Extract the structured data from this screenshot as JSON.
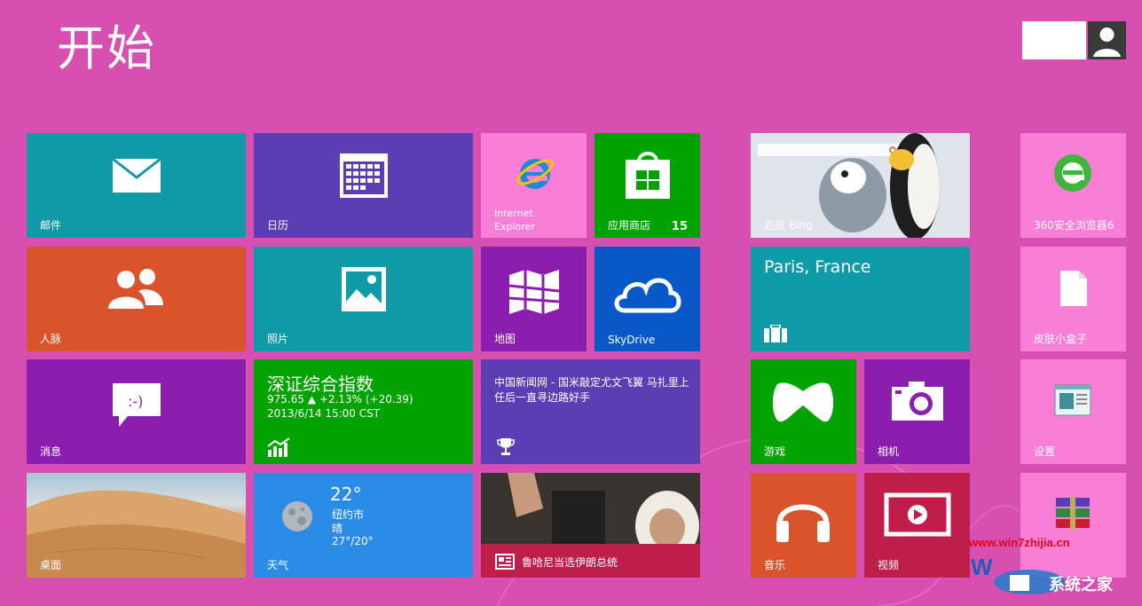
{
  "start": {
    "title": "开始"
  },
  "tiles": {
    "mail": {
      "label": "邮件",
      "color": "#0e9aa7"
    },
    "calendar": {
      "label": "日历",
      "color": "#5b3db4"
    },
    "ie": {
      "label_line1": "Internet",
      "label_line2": "Explorer",
      "color": "#f97ed7"
    },
    "store": {
      "label": "应用商店",
      "badge": "15",
      "color": "#00a300"
    },
    "bing": {
      "label": "必应 Bing"
    },
    "browser360": {
      "label": "360安全浏览器6",
      "color": "#f97ed7"
    },
    "people": {
      "label": "人脉",
      "color": "#d9532c"
    },
    "photos": {
      "label": "照片",
      "color": "#0e9aa7"
    },
    "maps": {
      "label": "地图",
      "color": "#8b1eae"
    },
    "skydrive": {
      "label": "SkyDrive",
      "color": "#0958c7"
    },
    "travel": {
      "city": "Paris, France",
      "color": "#0e9aa7"
    },
    "skinbox": {
      "label": "皮肤小盒子",
      "color": "#f97ed7"
    },
    "messaging": {
      "label": "消息",
      "color": "#8b1eae"
    },
    "finance": {
      "title": "深证综合指数",
      "line1": "975.65  ▲ +2.13% (+20.39)",
      "line2": "2013/6/14 15:00 CST",
      "color": "#00a300"
    },
    "news": {
      "text": "中国新闻网 - 国米敲定尤文飞翼 马扎里上任后一直寻边路好手",
      "color": "#5b3db4"
    },
    "games": {
      "label": "游戏",
      "color": "#00a300"
    },
    "camera": {
      "label": "相机",
      "color": "#8b1eae"
    },
    "settings": {
      "label": "设置",
      "color": "#f97ed7"
    },
    "desktop": {
      "label": "桌面"
    },
    "weather": {
      "temp": "22°",
      "city": "纽约市",
      "condition": "晴",
      "range": "27°/20°",
      "label": "天气",
      "color": "#2b8ce8"
    },
    "newsphoto": {
      "caption": "鲁哈尼当选伊朗总统",
      "color": "#bf1e4b"
    },
    "music": {
      "label": "音乐",
      "color": "#d9532c"
    },
    "video": {
      "label": "视频",
      "color": "#bf1e4b"
    }
  },
  "watermark": {
    "url": "www.win7zhijia.cn",
    "brand": "系统之家"
  }
}
